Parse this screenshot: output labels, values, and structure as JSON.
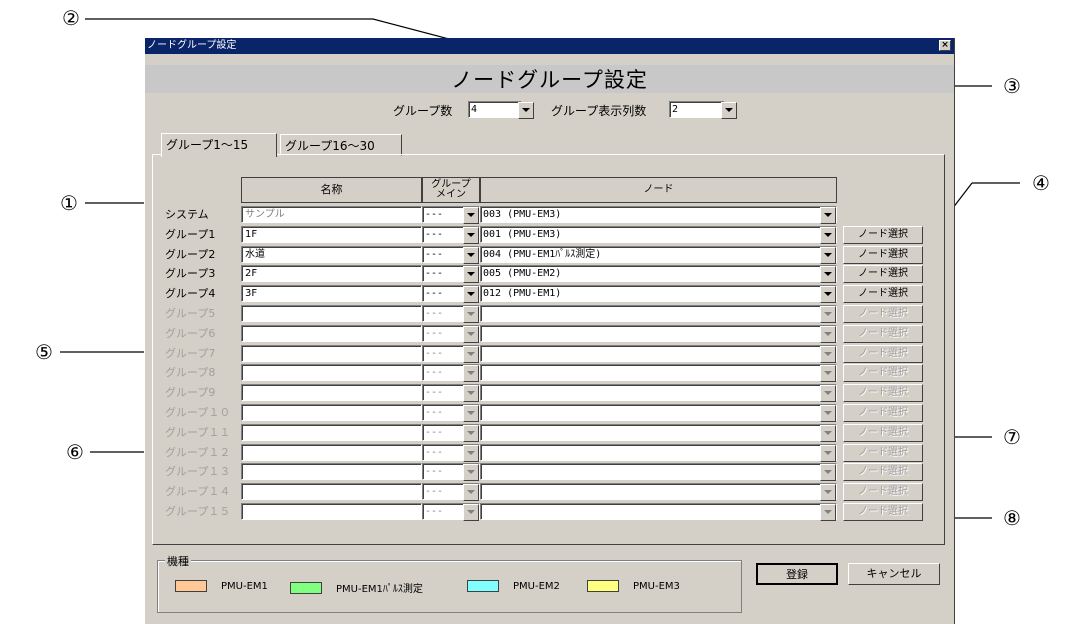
{
  "window": {
    "title": "ノードグループ設定",
    "close": "×"
  },
  "dialog_title": "ノードグループ設定",
  "group_count": {
    "label": "グループ数",
    "value": "4"
  },
  "group_cols": {
    "label": "グループ表示列数",
    "value": "2"
  },
  "tabs": [
    "グループ1～15",
    "グループ16～30"
  ],
  "table_headers": {
    "name": "名称",
    "main": "グループ\nメイン",
    "node": "ノード"
  },
  "rows": [
    {
      "label": "システム",
      "name": "サンプル",
      "main": "---",
      "node": "003 (PMU-EM3)",
      "enabled": true,
      "button": ""
    },
    {
      "label": "グループ1",
      "name": "1F",
      "main": "---",
      "node": "001 (PMU-EM3)",
      "enabled": true,
      "button": "ノード選択"
    },
    {
      "label": "グループ2",
      "name": "水道",
      "main": "---",
      "node": "004 (PMU-EM1ﾊﾟﾙｽ測定)",
      "enabled": true,
      "button": "ノード選択"
    },
    {
      "label": "グループ3",
      "name": "2F",
      "main": "---",
      "node": "005 (PMU-EM2)",
      "enabled": true,
      "button": "ノード選択"
    },
    {
      "label": "グループ4",
      "name": "3F",
      "main": "---",
      "node": "012 (PMU-EM1)",
      "enabled": true,
      "button": "ノード選択"
    },
    {
      "label": "グループ5",
      "name": "",
      "main": "---",
      "node": "",
      "enabled": false,
      "button": "ノード選択"
    },
    {
      "label": "グループ6",
      "name": "",
      "main": "---",
      "node": "",
      "enabled": false,
      "button": "ノード選択"
    },
    {
      "label": "グループ7",
      "name": "",
      "main": "---",
      "node": "",
      "enabled": false,
      "button": "ノード選択"
    },
    {
      "label": "グループ8",
      "name": "",
      "main": "---",
      "node": "",
      "enabled": false,
      "button": "ノード選択"
    },
    {
      "label": "グループ9",
      "name": "",
      "main": "---",
      "node": "",
      "enabled": false,
      "button": "ノード選択"
    },
    {
      "label": "グループ１０",
      "name": "",
      "main": "---",
      "node": "",
      "enabled": false,
      "button": "ノード選択"
    },
    {
      "label": "グループ１１",
      "name": "",
      "main": "---",
      "node": "",
      "enabled": false,
      "button": "ノード選択"
    },
    {
      "label": "グループ１２",
      "name": "",
      "main": "---",
      "node": "",
      "enabled": false,
      "button": "ノード選択"
    },
    {
      "label": "グループ１３",
      "name": "",
      "main": "---",
      "node": "",
      "enabled": false,
      "button": "ノード選択"
    },
    {
      "label": "グループ１４",
      "name": "",
      "main": "---",
      "node": "",
      "enabled": false,
      "button": "ノード選択"
    },
    {
      "label": "グループ１５",
      "name": "",
      "main": "---",
      "node": "",
      "enabled": false,
      "button": "ノード選択"
    }
  ],
  "kishu": {
    "label": "機種",
    "items": [
      {
        "name": "PMU-EM1",
        "color": "#ffc896"
      },
      {
        "name": "PMU-EM1ﾊﾟﾙｽ測定",
        "color": "#80ff80"
      },
      {
        "name": "PMU-EM2",
        "color": "#80ffff"
      },
      {
        "name": "PMU-EM3",
        "color": "#ffff80"
      }
    ]
  },
  "buttons": {
    "register": "登録",
    "cancel": "キャンセル"
  },
  "callouts": [
    "①",
    "②",
    "③",
    "④",
    "⑤",
    "⑥",
    "⑦",
    "⑧"
  ]
}
